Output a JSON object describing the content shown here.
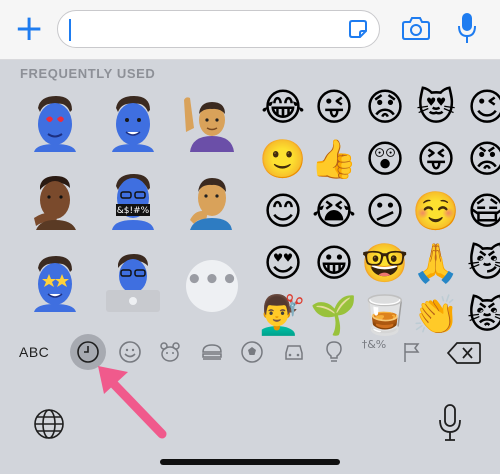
{
  "topbar": {
    "plus_label": "+",
    "input_value": ""
  },
  "section": {
    "title": "FREQUENTLY USED"
  },
  "emoji_grid": [
    [
      "😂",
      "😜",
      "😟",
      "😻",
      "😉"
    ],
    [
      "🙂",
      "👍",
      "😲",
      "😝",
      "😡"
    ],
    [
      "😊",
      "😭",
      "😕",
      "☺️",
      "😷"
    ],
    [
      "😍",
      "😀",
      "🤓",
      "🙏",
      "😼"
    ],
    [
      "💇‍♂️",
      "🌱",
      "🥃",
      "👏",
      "😾"
    ]
  ],
  "more_label": "•••",
  "category_bar": {
    "abc_label": "ABC",
    "categories": [
      "recent-icon",
      "smiley-icon",
      "animal-icon",
      "food-icon",
      "ball-icon",
      "car-icon",
      "bulb-icon",
      "symbols-icon",
      "flag-icon"
    ],
    "symbols_glyph": "†&%"
  },
  "colors": {
    "accent": "#1e7cf0",
    "arrow": "#f05a8c",
    "keyboard_bg": "#d2d5db"
  }
}
